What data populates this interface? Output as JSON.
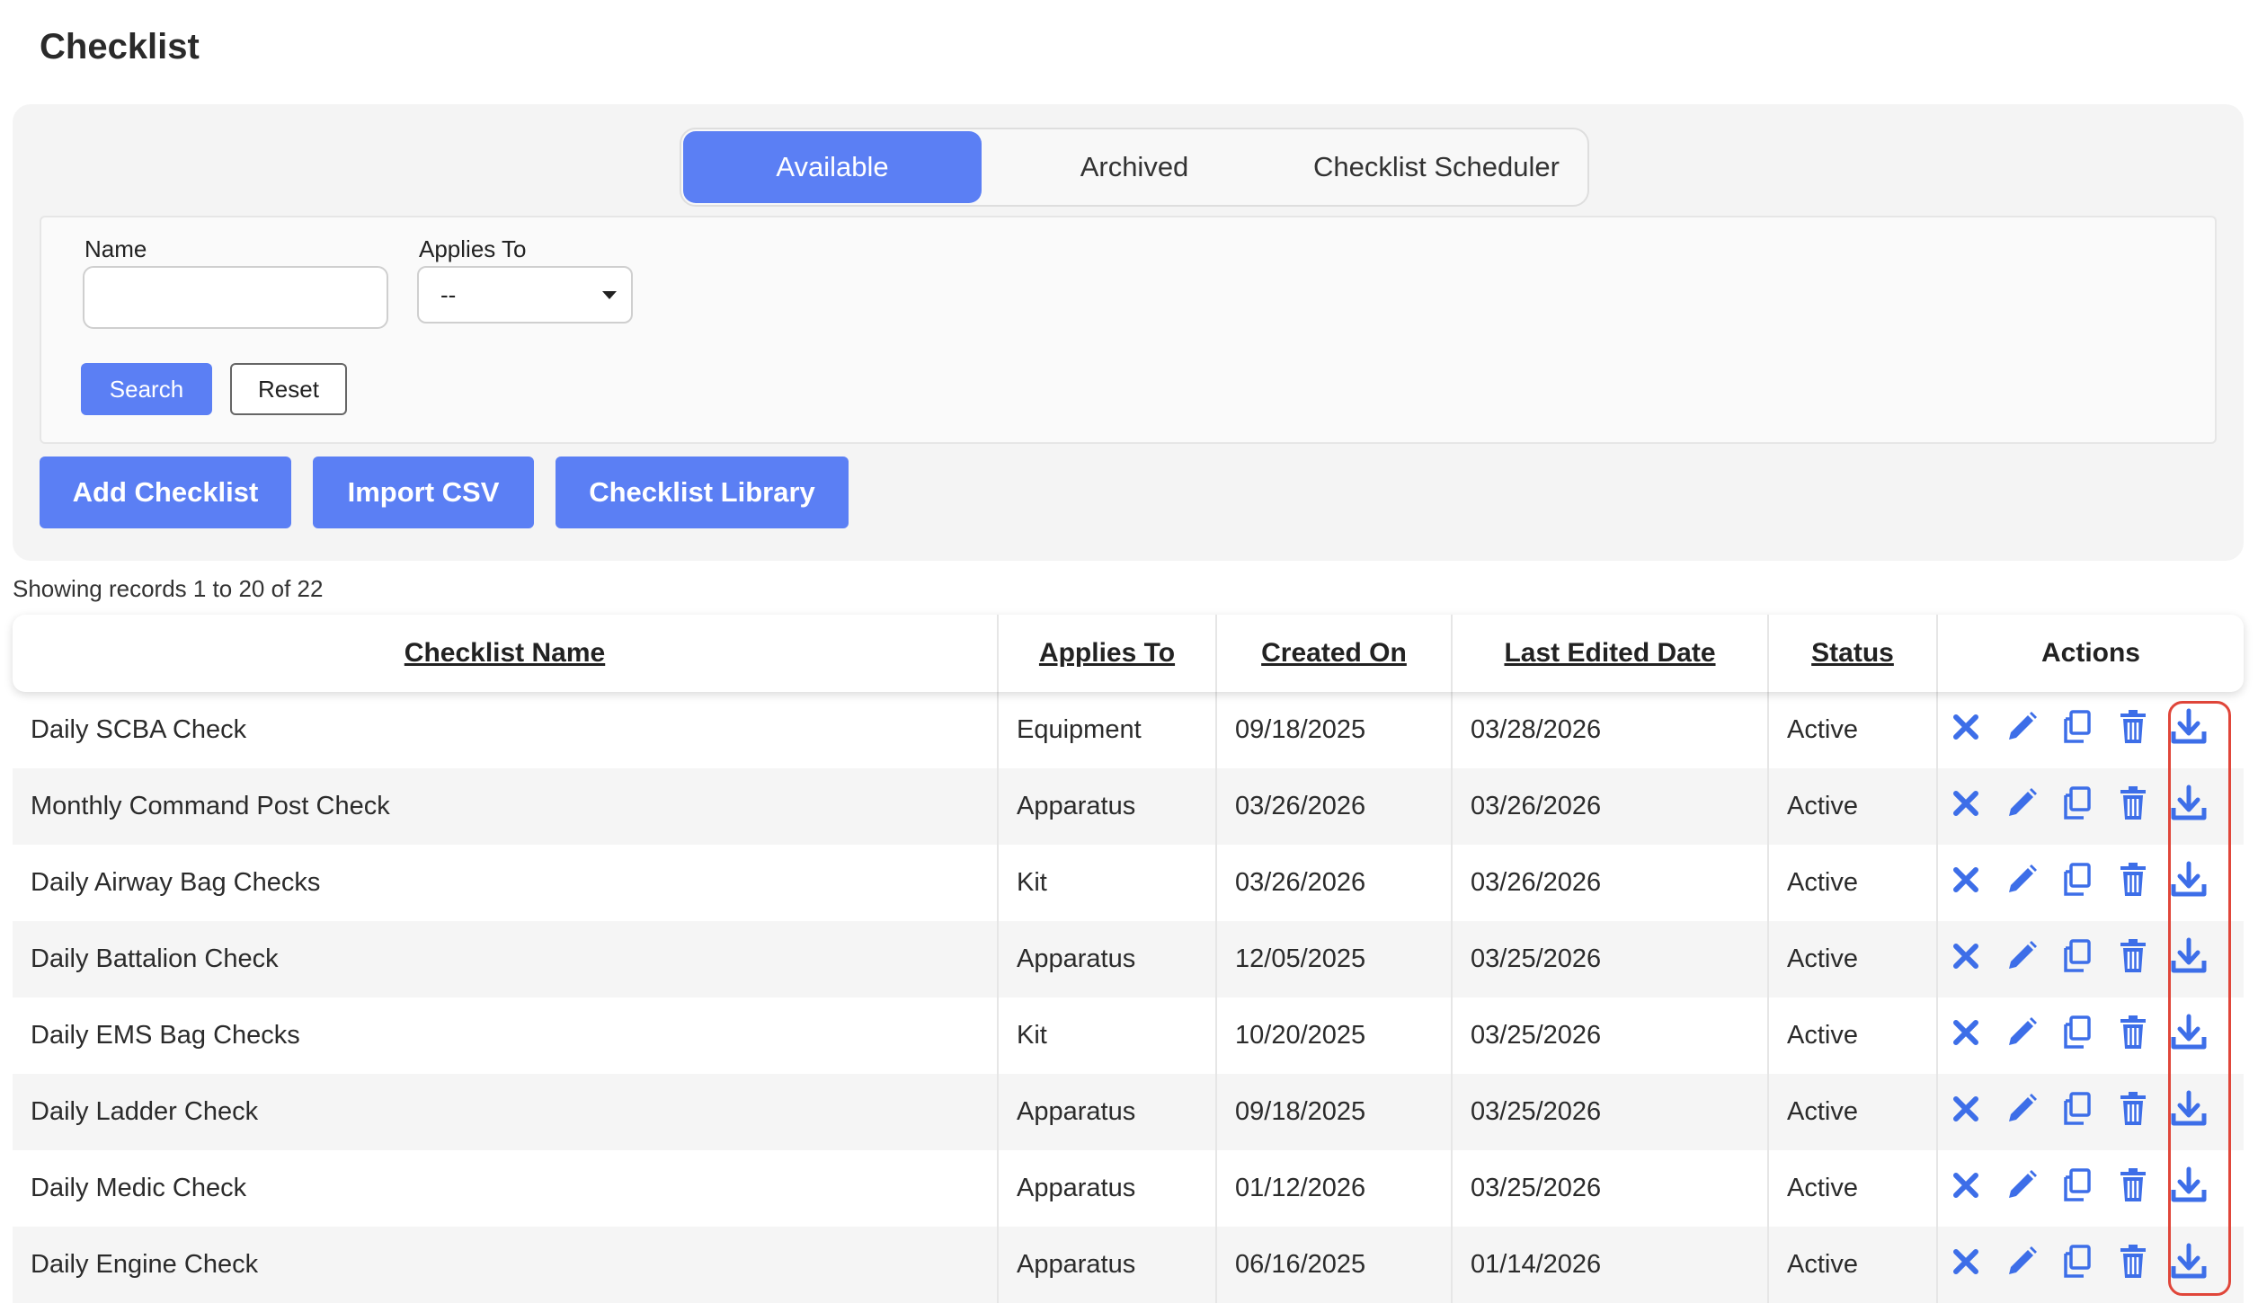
{
  "page": {
    "title": "Checklist"
  },
  "tabs": [
    {
      "label": "Available",
      "active": true
    },
    {
      "label": "Archived",
      "active": false
    },
    {
      "label": "Checklist Scheduler",
      "active": false
    }
  ],
  "filters": {
    "name_label": "Name",
    "name_value": "",
    "applies_to_label": "Applies To",
    "applies_to_value": "--",
    "search_label": "Search",
    "reset_label": "Reset"
  },
  "actions": {
    "add_label": "Add Checklist",
    "import_label": "Import CSV",
    "library_label": "Checklist Library"
  },
  "records_text": "Showing records 1 to 20 of 22",
  "table": {
    "headers": [
      "Checklist Name",
      "Applies To",
      "Created On",
      "Last Edited Date",
      "Status",
      "Actions"
    ],
    "rows": [
      {
        "name": "Daily SCBA Check",
        "applies": "Equipment",
        "created": "09/18/2025",
        "edited": "03/28/2026",
        "status": "Active"
      },
      {
        "name": "Monthly Command Post Check",
        "applies": "Apparatus",
        "created": "03/26/2026",
        "edited": "03/26/2026",
        "status": "Active"
      },
      {
        "name": "Daily Airway Bag Checks",
        "applies": "Kit",
        "created": "03/26/2026",
        "edited": "03/26/2026",
        "status": "Active"
      },
      {
        "name": "Daily Battalion Check",
        "applies": "Apparatus",
        "created": "12/05/2025",
        "edited": "03/25/2026",
        "status": "Active"
      },
      {
        "name": "Daily EMS Bag Checks",
        "applies": "Kit",
        "created": "10/20/2025",
        "edited": "03/25/2026",
        "status": "Active"
      },
      {
        "name": "Daily Ladder Check",
        "applies": "Apparatus",
        "created": "09/18/2025",
        "edited": "03/25/2026",
        "status": "Active"
      },
      {
        "name": "Daily Medic Check",
        "applies": "Apparatus",
        "created": "01/12/2026",
        "edited": "03/25/2026",
        "status": "Active"
      },
      {
        "name": "Daily Engine Check",
        "applies": "Apparatus",
        "created": "06/16/2025",
        "edited": "01/14/2026",
        "status": "Active"
      }
    ],
    "row_action_icons": [
      "close-icon",
      "pencil-icon",
      "copy-icon",
      "trash-icon",
      "download-icon"
    ]
  },
  "colors": {
    "accent": "#5b7ff4",
    "icon": "#3d6ee8",
    "highlight": "#e0463a"
  }
}
